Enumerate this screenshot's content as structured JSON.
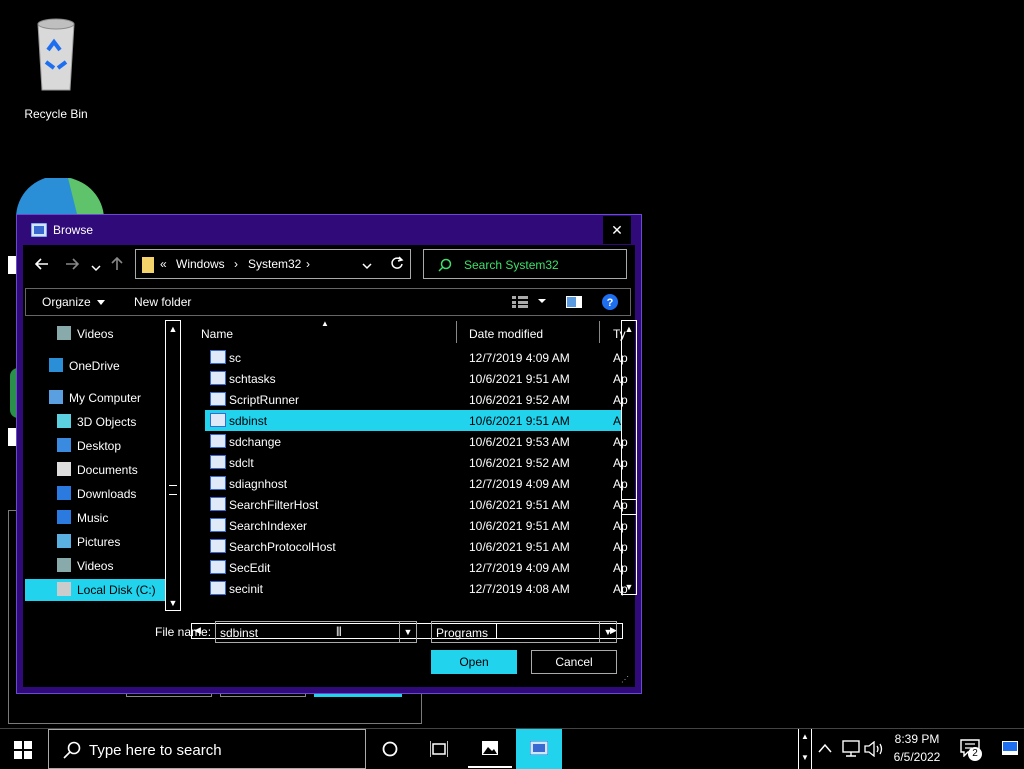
{
  "desktop": {
    "recycle_bin_label": "Recycle Bin"
  },
  "dialog": {
    "title": "Browse",
    "close_glyph": "✕",
    "address": {
      "overflow": "«",
      "crumb1": "Windows",
      "sep": "›",
      "crumb2": "System32",
      "sep2": "›"
    },
    "search_placeholder": "Search System32",
    "toolbar": {
      "organize": "Organize",
      "new_folder": "New folder"
    },
    "nav_items": [
      {
        "label": "Videos",
        "icon": "videos-icon"
      },
      {
        "label": "OneDrive",
        "icon": "onedrive-icon"
      },
      {
        "label": "My Computer",
        "icon": "computer-icon"
      },
      {
        "label": "3D Objects",
        "icon": "3d-objects-icon"
      },
      {
        "label": "Desktop",
        "icon": "desktop-folder-icon"
      },
      {
        "label": "Documents",
        "icon": "documents-icon"
      },
      {
        "label": "Downloads",
        "icon": "downloads-icon"
      },
      {
        "label": "Music",
        "icon": "music-icon"
      },
      {
        "label": "Pictures",
        "icon": "pictures-icon"
      },
      {
        "label": "Videos",
        "icon": "videos-icon"
      },
      {
        "label": "Local Disk (C:)",
        "icon": "drive-icon"
      }
    ],
    "columns": {
      "name": "Name",
      "date": "Date modified",
      "type": "Ty"
    },
    "files": [
      {
        "name": "sc",
        "date": "12/7/2019 4:09 AM",
        "type": "Ap"
      },
      {
        "name": "schtasks",
        "date": "10/6/2021 9:51 AM",
        "type": "Ap"
      },
      {
        "name": "ScriptRunner",
        "date": "10/6/2021 9:52 AM",
        "type": "Ap"
      },
      {
        "name": "sdbinst",
        "date": "10/6/2021 9:51 AM",
        "type": "Ap"
      },
      {
        "name": "sdchange",
        "date": "10/6/2021 9:53 AM",
        "type": "Ap"
      },
      {
        "name": "sdclt",
        "date": "10/6/2021 9:52 AM",
        "type": "Ap"
      },
      {
        "name": "sdiagnhost",
        "date": "12/7/2019 4:09 AM",
        "type": "Ap"
      },
      {
        "name": "SearchFilterHost",
        "date": "10/6/2021 9:51 AM",
        "type": "Ap"
      },
      {
        "name": "SearchIndexer",
        "date": "10/6/2021 9:51 AM",
        "type": "Ap"
      },
      {
        "name": "SearchProtocolHost",
        "date": "10/6/2021 9:51 AM",
        "type": "Ap"
      },
      {
        "name": "SecEdit",
        "date": "12/7/2019 4:09 AM",
        "type": "Ap"
      },
      {
        "name": "secinit",
        "date": "12/7/2019 4:08 AM",
        "type": "Ap"
      }
    ],
    "file_name_label": "File name:",
    "file_name_value": "sdbinst",
    "file_type_value": "Programs",
    "open_label": "Open",
    "cancel_label": "Cancel"
  },
  "taskbar": {
    "search_placeholder": "Type here to search",
    "time": "8:39 PM",
    "date": "6/5/2022",
    "notification_count": "2"
  },
  "colors": {
    "accent": "#22d3ee",
    "dialog_frame": "#300a78",
    "search_text": "#3ee06a"
  }
}
